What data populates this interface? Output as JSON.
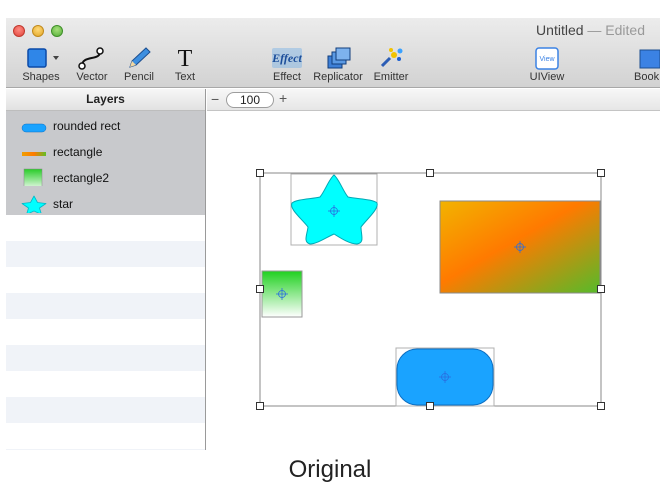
{
  "window": {
    "title": "Untitled",
    "title_suffix": "— Edited"
  },
  "toolbar": {
    "shapes": "Shapes",
    "vector": "Vector",
    "pencil": "Pencil",
    "text": "Text",
    "effect": "Effect",
    "effect_icon_text": "Effect",
    "replicator": "Replicator",
    "emitter": "Emitter",
    "uiview": "UIView",
    "uiview_icon_text": "View",
    "book": "Book"
  },
  "sidebar": {
    "header": "Layers",
    "layers": [
      {
        "label": "rounded rect",
        "icon": "rounded-rect-icon"
      },
      {
        "label": "rectangle",
        "icon": "rectangle-icon"
      },
      {
        "label": "rectangle2",
        "icon": "gradient-rect-icon"
      },
      {
        "label": "star",
        "icon": "star-icon"
      }
    ]
  },
  "zoom": {
    "minus": "−",
    "value": "100",
    "plus": "+"
  },
  "colors": {
    "star_fill": "#00ffff",
    "rounded_rect_fill": "#1aa3ff",
    "rect_gradient": [
      "#f0a000",
      "#ff7a00",
      "#5fbf28"
    ],
    "rect2_gradient": [
      "#28cc28",
      "#ffffff"
    ],
    "selection": "#8a8a8a",
    "anchor": "#2a6de0"
  },
  "caption": "Original"
}
